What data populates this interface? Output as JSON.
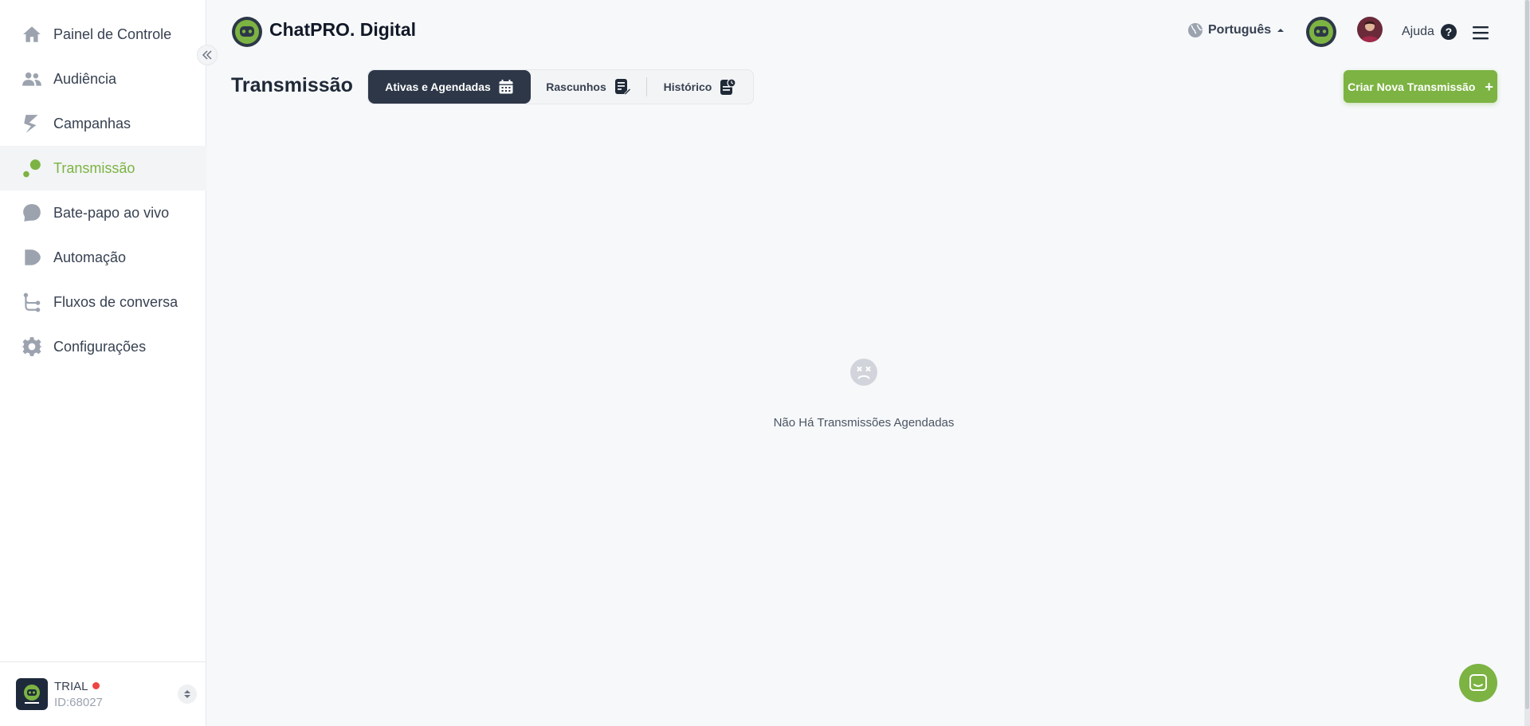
{
  "sidebar": {
    "items": [
      {
        "label": "Painel de Controle",
        "icon": "home-icon"
      },
      {
        "label": "Audiência",
        "icon": "users-icon"
      },
      {
        "label": "Campanhas",
        "icon": "campaign-icon"
      },
      {
        "label": "Transmissão",
        "icon": "broadcast-icon",
        "active": true
      },
      {
        "label": "Bate-papo ao vivo",
        "icon": "chat-icon"
      },
      {
        "label": "Automação",
        "icon": "automation-icon"
      },
      {
        "label": "Fluxos de conversa",
        "icon": "flow-icon"
      },
      {
        "label": "Configurações",
        "icon": "gear-icon"
      }
    ],
    "account": {
      "plan": "TRIAL",
      "id": "ID:68027"
    }
  },
  "header": {
    "brand": "ChatPRO. Digital",
    "language": "Português",
    "help": "Ajuda"
  },
  "main": {
    "title": "Transmissão",
    "tabs": [
      {
        "label": "Ativas e Agendadas",
        "icon": "calendar-icon"
      },
      {
        "label": "Rascunhos",
        "icon": "draft-icon"
      },
      {
        "label": "Histórico",
        "icon": "history-icon"
      }
    ],
    "create_button": "Criar Nova Transmissão",
    "empty_state": "Não Há Transmissões Agendadas"
  },
  "colors": {
    "accent": "#7cb342",
    "dark_tab": "#2d3748",
    "account_dot": "#ef4444"
  }
}
